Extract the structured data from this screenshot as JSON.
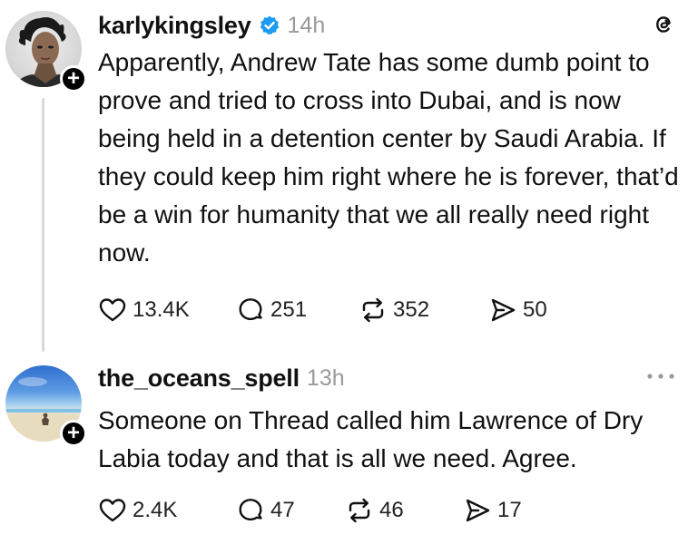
{
  "posts": [
    {
      "username": "karlykingsley",
      "verified": true,
      "time": "14h",
      "corner_icon": "threads-logo-icon",
      "text": "Apparently, Andrew Tate has some dumb point to prove and tried to cross into Dubai, and is now being held in a detention center by Saudi Arabia. If they could keep him right where he is forever, that’d be a win for humanity that we all really need right now.",
      "likes": "13.4K",
      "replies": "251",
      "reposts": "352",
      "shares": "50"
    },
    {
      "username": "the_oceans_spell",
      "verified": false,
      "time": "13h",
      "corner_icon": "more-options-icon",
      "text": "Someone on Thread called him Lawrence of Dry Labia today and that is all we need. Agree.",
      "likes": "2.4K",
      "replies": "47",
      "reposts": "46",
      "shares": "17"
    }
  ],
  "follow_badge": "+",
  "colors": {
    "text": "#111111",
    "muted": "#9a9a9a",
    "verified": "#1d9bf0",
    "thread_line": "#d9d9d9"
  }
}
